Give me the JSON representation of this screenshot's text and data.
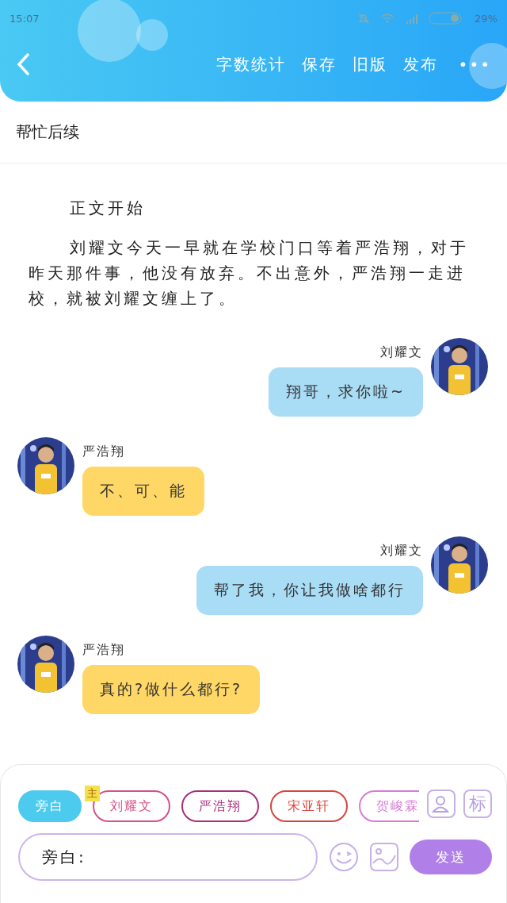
{
  "status_bar": {
    "time": "15:07",
    "battery": "29%"
  },
  "toolbar": {
    "actions": [
      "字数统计",
      "保存",
      "旧版",
      "发布"
    ],
    "more": "•••"
  },
  "chapter_title": "帮忙后续",
  "paragraphs": [
    "正文开始",
    "刘耀文今天一早就在学校门口等着严浩翔，对于昨天那件事，他没有放弃。不出意外，严浩翔一走进校，就被刘耀文缠上了。"
  ],
  "messages": [
    {
      "kind": "outgoing",
      "name": "刘耀文",
      "text": "翔哥，求你啦~"
    },
    {
      "kind": "incoming",
      "name": "严浩翔",
      "text": "不、可、能"
    },
    {
      "kind": "outgoing",
      "name": "刘耀文",
      "text": "帮了我，你让我做啥都行"
    },
    {
      "kind": "incoming",
      "name": "严浩翔",
      "text": "真的?做什么都行?"
    }
  ],
  "roles": [
    {
      "label": "旁白",
      "selected": true,
      "color": "#4ccbef"
    },
    {
      "label": "刘耀文",
      "selected": false,
      "color": "#d6508a",
      "badge": "主"
    },
    {
      "label": "严浩翔",
      "selected": false,
      "color": "#a8307e"
    },
    {
      "label": "宋亚轩",
      "selected": false,
      "color": "#d5463e"
    },
    {
      "label": "贺峻霖",
      "selected": false,
      "color": "#d87ad8"
    }
  ],
  "tag_button": "标",
  "input": {
    "value": "旁白:"
  },
  "send_button": "发送"
}
